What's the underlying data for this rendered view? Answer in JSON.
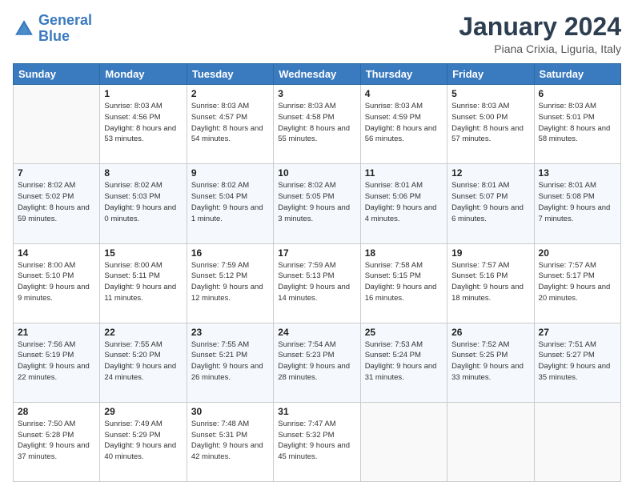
{
  "header": {
    "logo_line1": "General",
    "logo_line2": "Blue",
    "month_title": "January 2024",
    "subtitle": "Piana Crixia, Liguria, Italy"
  },
  "columns": [
    "Sunday",
    "Monday",
    "Tuesday",
    "Wednesday",
    "Thursday",
    "Friday",
    "Saturday"
  ],
  "weeks": [
    [
      {
        "day": "",
        "sunrise": "",
        "sunset": "",
        "daylight": ""
      },
      {
        "day": "1",
        "sunrise": "Sunrise: 8:03 AM",
        "sunset": "Sunset: 4:56 PM",
        "daylight": "Daylight: 8 hours and 53 minutes."
      },
      {
        "day": "2",
        "sunrise": "Sunrise: 8:03 AM",
        "sunset": "Sunset: 4:57 PM",
        "daylight": "Daylight: 8 hours and 54 minutes."
      },
      {
        "day": "3",
        "sunrise": "Sunrise: 8:03 AM",
        "sunset": "Sunset: 4:58 PM",
        "daylight": "Daylight: 8 hours and 55 minutes."
      },
      {
        "day": "4",
        "sunrise": "Sunrise: 8:03 AM",
        "sunset": "Sunset: 4:59 PM",
        "daylight": "Daylight: 8 hours and 56 minutes."
      },
      {
        "day": "5",
        "sunrise": "Sunrise: 8:03 AM",
        "sunset": "Sunset: 5:00 PM",
        "daylight": "Daylight: 8 hours and 57 minutes."
      },
      {
        "day": "6",
        "sunrise": "Sunrise: 8:03 AM",
        "sunset": "Sunset: 5:01 PM",
        "daylight": "Daylight: 8 hours and 58 minutes."
      }
    ],
    [
      {
        "day": "7",
        "sunrise": "Sunrise: 8:02 AM",
        "sunset": "Sunset: 5:02 PM",
        "daylight": "Daylight: 8 hours and 59 minutes."
      },
      {
        "day": "8",
        "sunrise": "Sunrise: 8:02 AM",
        "sunset": "Sunset: 5:03 PM",
        "daylight": "Daylight: 9 hours and 0 minutes."
      },
      {
        "day": "9",
        "sunrise": "Sunrise: 8:02 AM",
        "sunset": "Sunset: 5:04 PM",
        "daylight": "Daylight: 9 hours and 1 minute."
      },
      {
        "day": "10",
        "sunrise": "Sunrise: 8:02 AM",
        "sunset": "Sunset: 5:05 PM",
        "daylight": "Daylight: 9 hours and 3 minutes."
      },
      {
        "day": "11",
        "sunrise": "Sunrise: 8:01 AM",
        "sunset": "Sunset: 5:06 PM",
        "daylight": "Daylight: 9 hours and 4 minutes."
      },
      {
        "day": "12",
        "sunrise": "Sunrise: 8:01 AM",
        "sunset": "Sunset: 5:07 PM",
        "daylight": "Daylight: 9 hours and 6 minutes."
      },
      {
        "day": "13",
        "sunrise": "Sunrise: 8:01 AM",
        "sunset": "Sunset: 5:08 PM",
        "daylight": "Daylight: 9 hours and 7 minutes."
      }
    ],
    [
      {
        "day": "14",
        "sunrise": "Sunrise: 8:00 AM",
        "sunset": "Sunset: 5:10 PM",
        "daylight": "Daylight: 9 hours and 9 minutes."
      },
      {
        "day": "15",
        "sunrise": "Sunrise: 8:00 AM",
        "sunset": "Sunset: 5:11 PM",
        "daylight": "Daylight: 9 hours and 11 minutes."
      },
      {
        "day": "16",
        "sunrise": "Sunrise: 7:59 AM",
        "sunset": "Sunset: 5:12 PM",
        "daylight": "Daylight: 9 hours and 12 minutes."
      },
      {
        "day": "17",
        "sunrise": "Sunrise: 7:59 AM",
        "sunset": "Sunset: 5:13 PM",
        "daylight": "Daylight: 9 hours and 14 minutes."
      },
      {
        "day": "18",
        "sunrise": "Sunrise: 7:58 AM",
        "sunset": "Sunset: 5:15 PM",
        "daylight": "Daylight: 9 hours and 16 minutes."
      },
      {
        "day": "19",
        "sunrise": "Sunrise: 7:57 AM",
        "sunset": "Sunset: 5:16 PM",
        "daylight": "Daylight: 9 hours and 18 minutes."
      },
      {
        "day": "20",
        "sunrise": "Sunrise: 7:57 AM",
        "sunset": "Sunset: 5:17 PM",
        "daylight": "Daylight: 9 hours and 20 minutes."
      }
    ],
    [
      {
        "day": "21",
        "sunrise": "Sunrise: 7:56 AM",
        "sunset": "Sunset: 5:19 PM",
        "daylight": "Daylight: 9 hours and 22 minutes."
      },
      {
        "day": "22",
        "sunrise": "Sunrise: 7:55 AM",
        "sunset": "Sunset: 5:20 PM",
        "daylight": "Daylight: 9 hours and 24 minutes."
      },
      {
        "day": "23",
        "sunrise": "Sunrise: 7:55 AM",
        "sunset": "Sunset: 5:21 PM",
        "daylight": "Daylight: 9 hours and 26 minutes."
      },
      {
        "day": "24",
        "sunrise": "Sunrise: 7:54 AM",
        "sunset": "Sunset: 5:23 PM",
        "daylight": "Daylight: 9 hours and 28 minutes."
      },
      {
        "day": "25",
        "sunrise": "Sunrise: 7:53 AM",
        "sunset": "Sunset: 5:24 PM",
        "daylight": "Daylight: 9 hours and 31 minutes."
      },
      {
        "day": "26",
        "sunrise": "Sunrise: 7:52 AM",
        "sunset": "Sunset: 5:25 PM",
        "daylight": "Daylight: 9 hours and 33 minutes."
      },
      {
        "day": "27",
        "sunrise": "Sunrise: 7:51 AM",
        "sunset": "Sunset: 5:27 PM",
        "daylight": "Daylight: 9 hours and 35 minutes."
      }
    ],
    [
      {
        "day": "28",
        "sunrise": "Sunrise: 7:50 AM",
        "sunset": "Sunset: 5:28 PM",
        "daylight": "Daylight: 9 hours and 37 minutes."
      },
      {
        "day": "29",
        "sunrise": "Sunrise: 7:49 AM",
        "sunset": "Sunset: 5:29 PM",
        "daylight": "Daylight: 9 hours and 40 minutes."
      },
      {
        "day": "30",
        "sunrise": "Sunrise: 7:48 AM",
        "sunset": "Sunset: 5:31 PM",
        "daylight": "Daylight: 9 hours and 42 minutes."
      },
      {
        "day": "31",
        "sunrise": "Sunrise: 7:47 AM",
        "sunset": "Sunset: 5:32 PM",
        "daylight": "Daylight: 9 hours and 45 minutes."
      },
      {
        "day": "",
        "sunrise": "",
        "sunset": "",
        "daylight": ""
      },
      {
        "day": "",
        "sunrise": "",
        "sunset": "",
        "daylight": ""
      },
      {
        "day": "",
        "sunrise": "",
        "sunset": "",
        "daylight": ""
      }
    ]
  ]
}
